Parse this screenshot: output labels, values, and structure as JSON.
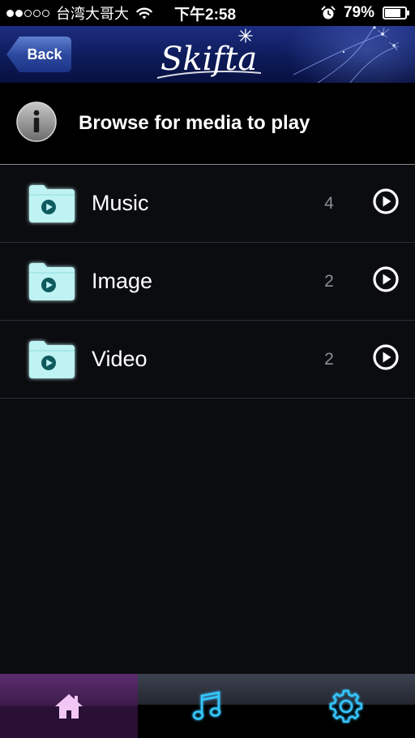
{
  "status_bar": {
    "signal_dots": [
      "on",
      "on",
      "off",
      "off",
      "off"
    ],
    "carrier": "台湾大哥大",
    "time": "下午2:58",
    "battery_percent": "79%",
    "battery_level": 0.79,
    "icons": [
      "wifi-icon",
      "alarm-icon",
      "battery-icon"
    ]
  },
  "header": {
    "back_label": "Back",
    "logo_text": "Skifta",
    "accent_color": "#1d2d80"
  },
  "info": {
    "icon": "info-icon",
    "title": "Browse for media to play"
  },
  "media_list": {
    "items": [
      {
        "label": "Music",
        "count": "4",
        "icon": "folder-play-icon",
        "action_icon": "play-circle-icon"
      },
      {
        "label": "Image",
        "count": "2",
        "icon": "folder-play-icon",
        "action_icon": "play-circle-icon"
      },
      {
        "label": "Video",
        "count": "2",
        "icon": "folder-play-icon",
        "action_icon": "play-circle-icon"
      }
    ],
    "folder_color": "#bff3f3"
  },
  "tab_bar": {
    "tabs": [
      {
        "name": "home",
        "icon": "home-icon",
        "selected": true,
        "color": "#f2c7f5"
      },
      {
        "name": "music",
        "icon": "music-note-icon",
        "selected": false,
        "color": "#35c6ff"
      },
      {
        "name": "settings",
        "icon": "gear-icon",
        "selected": false,
        "color": "#35c6ff"
      }
    ]
  }
}
